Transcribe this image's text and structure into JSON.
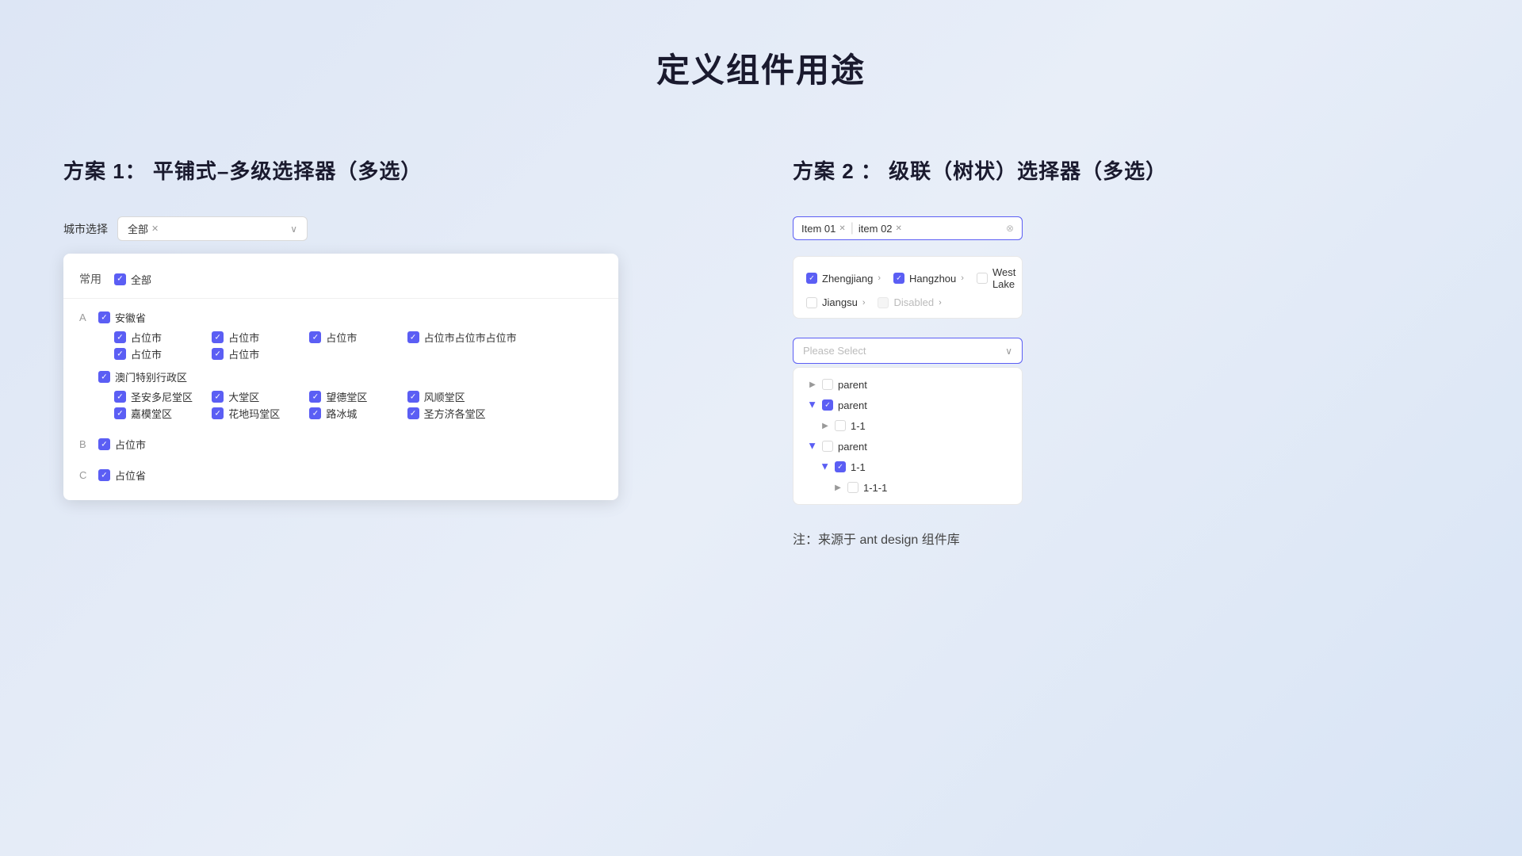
{
  "page": {
    "title": "定义组件用途"
  },
  "left_panel": {
    "title": "方案 1： 平铺式–多级选择器（多选）",
    "selector_label": "城市选择",
    "tag_all": "全部",
    "arrow": "∨",
    "dropdown": {
      "common_label": "常用",
      "all_label": "全部",
      "groups": [
        {
          "letter": "A",
          "province": "安徽省",
          "cities": [
            "占位市",
            "占位市",
            "占位市",
            "占位市占位市占位市"
          ],
          "cities2": [
            "占位市",
            "占位市"
          ],
          "sub_province": "澳门特别行政区",
          "sub_cities": [
            "圣安多尼堂区",
            "大堂区",
            "望德堂区",
            "风顺堂区"
          ],
          "sub_cities2": [
            "嘉模堂区",
            "花地玛堂区",
            "路冰城",
            "圣方济各堂区"
          ]
        },
        {
          "letter": "B",
          "province": "占位市"
        },
        {
          "letter": "C",
          "province": "占位省"
        }
      ]
    }
  },
  "right_panel": {
    "title": "方案 2 ： 级联（树状）选择器（多选）",
    "tag1": "Item 01",
    "tag2": "item 02",
    "select_placeholder": "Please Select",
    "cascader_header": [
      {
        "label": "Zhengjiang",
        "checked": true,
        "has_arrow": true
      },
      {
        "label": "Hangzhou",
        "checked": true,
        "has_arrow": true
      },
      {
        "label": "West Lake",
        "checked": false,
        "has_arrow": false
      },
      {
        "label": "Jiangsu",
        "checked": false,
        "has_arrow": true,
        "disabled": false
      },
      {
        "label": "Disabled",
        "checked": false,
        "has_arrow": true,
        "disabled": true
      }
    ],
    "tree": [
      {
        "level": 0,
        "arrow": "right",
        "checked": false,
        "label": "parent",
        "indent": 0
      },
      {
        "level": 0,
        "arrow": "down",
        "checked": true,
        "label": "parent",
        "indent": 0
      },
      {
        "level": 1,
        "arrow": "right",
        "checked": false,
        "label": "1-1",
        "indent": 1
      },
      {
        "level": 0,
        "arrow": "down",
        "checked": false,
        "label": "parent",
        "indent": 0
      },
      {
        "level": 1,
        "arrow": "down",
        "checked": false,
        "label": "1-1",
        "indent": 1
      },
      {
        "level": 2,
        "arrow": "right",
        "checked": false,
        "label": "1-1-1",
        "indent": 2
      }
    ],
    "note": "注：来源于 ant design 组件库"
  }
}
